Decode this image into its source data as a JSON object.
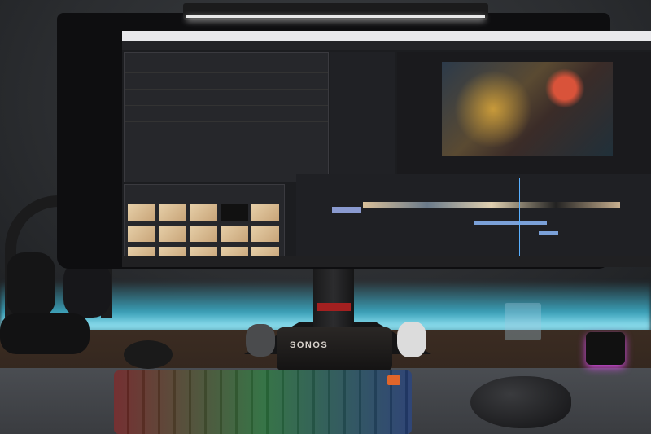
{
  "scene": {
    "speaker_brand": "SONOS",
    "accent_glow": "#3aa0b8",
    "screen_app": {
      "panels": [
        "effect-controls",
        "source-monitor",
        "program-monitor",
        "project-bin",
        "timeline",
        "taskbar"
      ],
      "playhead_color": "#5ab0ff"
    }
  }
}
